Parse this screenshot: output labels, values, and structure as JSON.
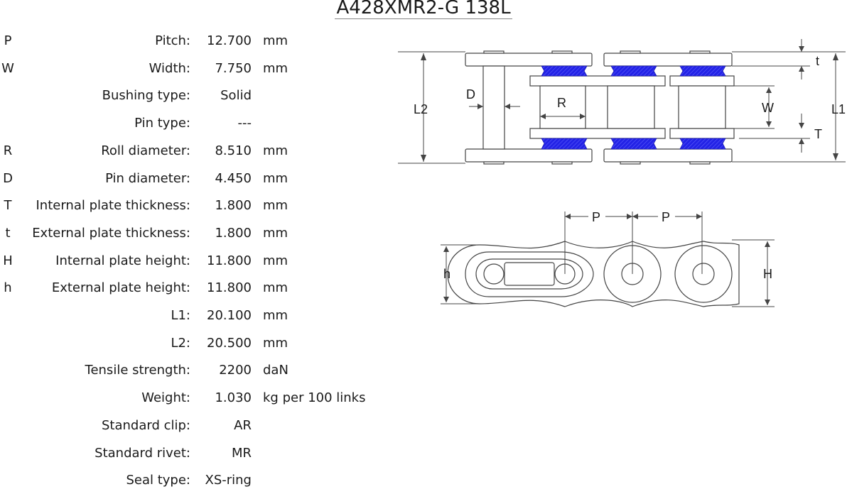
{
  "title": "A428XMR2-G 138L",
  "specs": [
    {
      "symbol": "P",
      "label": "Pitch:",
      "value": "12.700",
      "unit": "mm"
    },
    {
      "symbol": "W",
      "label": "Width:",
      "value": "7.750",
      "unit": "mm"
    },
    {
      "symbol": "",
      "label": "Bushing type:",
      "value": "Solid",
      "unit": ""
    },
    {
      "symbol": "",
      "label": "Pin type:",
      "value": "---",
      "unit": ""
    },
    {
      "symbol": "R",
      "label": "Roll diameter:",
      "value": "8.510",
      "unit": "mm"
    },
    {
      "symbol": "D",
      "label": "Pin diameter:",
      "value": "4.450",
      "unit": "mm"
    },
    {
      "symbol": "T",
      "label": "Internal plate thickness:",
      "value": "1.800",
      "unit": "mm"
    },
    {
      "symbol": "t",
      "label": "External plate thickness:",
      "value": "1.800",
      "unit": "mm"
    },
    {
      "symbol": "H",
      "label": "Internal plate height:",
      "value": "11.800",
      "unit": "mm"
    },
    {
      "symbol": "h",
      "label": "External plate height:",
      "value": "11.800",
      "unit": "mm"
    },
    {
      "symbol": "",
      "label": "L1:",
      "value": "20.100",
      "unit": "mm"
    },
    {
      "symbol": "",
      "label": "L2:",
      "value": "20.500",
      "unit": "mm"
    },
    {
      "symbol": "",
      "label": "Tensile strength:",
      "value": "2200",
      "unit": "daN"
    },
    {
      "symbol": "",
      "label": "Weight:",
      "value": "1.030",
      "unit": "kg per 100 links"
    },
    {
      "symbol": "",
      "label": "Standard clip:",
      "value": "AR",
      "unit": ""
    },
    {
      "symbol": "",
      "label": "Standard rivet:",
      "value": "MR",
      "unit": ""
    },
    {
      "symbol": "",
      "label": "Seal type:",
      "value": "XS-ring",
      "unit": ""
    }
  ],
  "diagram_labels": {
    "t": "t",
    "D": "D",
    "L2": "L2",
    "R": "R",
    "W": "W",
    "L1": "L1",
    "T": "T",
    "P1": "P",
    "P2": "P",
    "h": "h",
    "H": "H"
  },
  "colors": {
    "seal": "#2323e6",
    "text": "#1a1a1a",
    "line": "#444444"
  }
}
